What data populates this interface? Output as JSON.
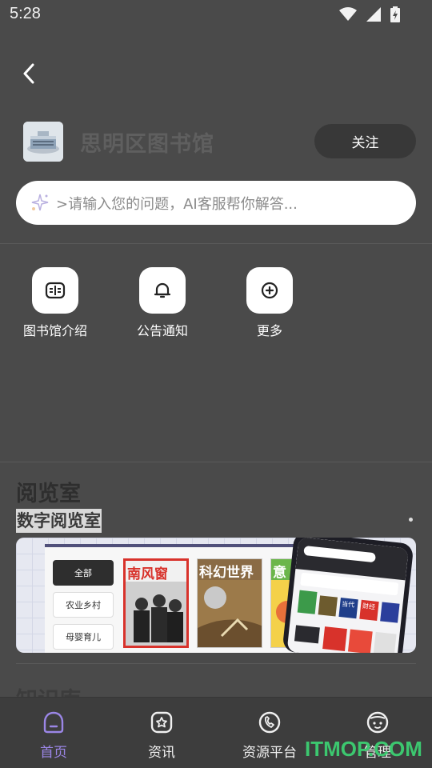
{
  "status_bar": {
    "time": "5:28"
  },
  "header": {
    "library_name": "思明区图书馆",
    "follow_label": "关注"
  },
  "search": {
    "placeholder": ">请输入您的问题，AI客服帮你解答..."
  },
  "quick_actions": [
    {
      "label": "图书馆介绍",
      "icon": "book-icon"
    },
    {
      "label": "公告通知",
      "icon": "bell-icon"
    },
    {
      "label": "更多",
      "icon": "plus-circle-icon"
    }
  ],
  "reading_room": {
    "title": "阅览室",
    "subtitle": "数字阅览室",
    "banner": {
      "categories": [
        "全部",
        "农业乡村",
        "母婴育儿"
      ],
      "magazines": [
        "南风窗",
        "科幻世界",
        "意"
      ],
      "phone_tags": [
        "当代",
        "财经"
      ]
    }
  },
  "knowledge": {
    "title": "知识库"
  },
  "bottom_nav": [
    {
      "label": "首页",
      "icon": "home-icon",
      "active": true
    },
    {
      "label": "资讯",
      "icon": "news-icon",
      "active": false
    },
    {
      "label": "资源平台",
      "icon": "resource-icon",
      "active": false
    },
    {
      "label": "管理",
      "icon": "manage-icon",
      "active": false
    }
  ],
  "watermark": "ITMOP.COM",
  "colors": {
    "background": "#4a4a4a",
    "accent": "#9b86e6",
    "watermark": "#3cc76f"
  }
}
